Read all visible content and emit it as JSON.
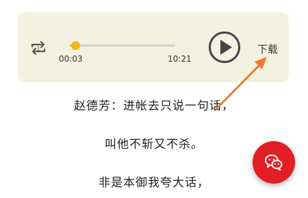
{
  "player": {
    "current_time": "00:03",
    "total_time": "10:21",
    "progress": 0.05,
    "download_label": "下载",
    "repeat_icon": "repeat-one-icon",
    "play_icon": "play-icon"
  },
  "lyrics": [
    "赵德芳：进帐去只说一句话，",
    "叫他不斩又不杀。",
    "非是本御我夸大话，"
  ],
  "fab": {
    "icon": "wechat-icon"
  },
  "colors": {
    "accent": "#f3b51c",
    "player_bg": "#f3f1df",
    "fab": "#e31e24",
    "annotation_arrow": "#f07a2a"
  }
}
